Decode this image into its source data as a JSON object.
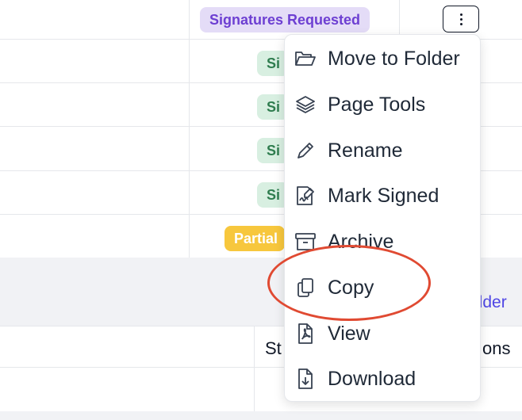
{
  "header_row": {
    "status_badge": "Signatures Requested"
  },
  "rows": [
    {
      "status_badge": "Si"
    },
    {
      "status_badge": "Si"
    },
    {
      "status_badge": "Si"
    },
    {
      "status_badge": "Si"
    },
    {
      "status_badge": "Partial"
    }
  ],
  "section_link": "older",
  "table_header": {
    "status_col": "St",
    "actions_col": "ons"
  },
  "menu": {
    "items": [
      {
        "label": "Move to Folder",
        "icon": "folder-open-icon"
      },
      {
        "label": "Page Tools",
        "icon": "layers-icon"
      },
      {
        "label": "Rename",
        "icon": "pencil-icon"
      },
      {
        "label": "Mark Signed",
        "icon": "signature-icon"
      },
      {
        "label": "Archive",
        "icon": "archive-icon"
      },
      {
        "label": "Copy",
        "icon": "copy-icon"
      },
      {
        "label": "View",
        "icon": "pdf-file-icon"
      },
      {
        "label": "Download",
        "icon": "download-file-icon"
      }
    ]
  },
  "colors": {
    "purple_badge_bg": "#e4dcf7",
    "purple_badge_text": "#6d3fd2",
    "green_badge_bg": "#d8efe1",
    "green_badge_text": "#2f7d4f",
    "yellow_badge_bg": "#f7c73d",
    "link": "#4f46e5",
    "highlight": "#e04a32"
  }
}
